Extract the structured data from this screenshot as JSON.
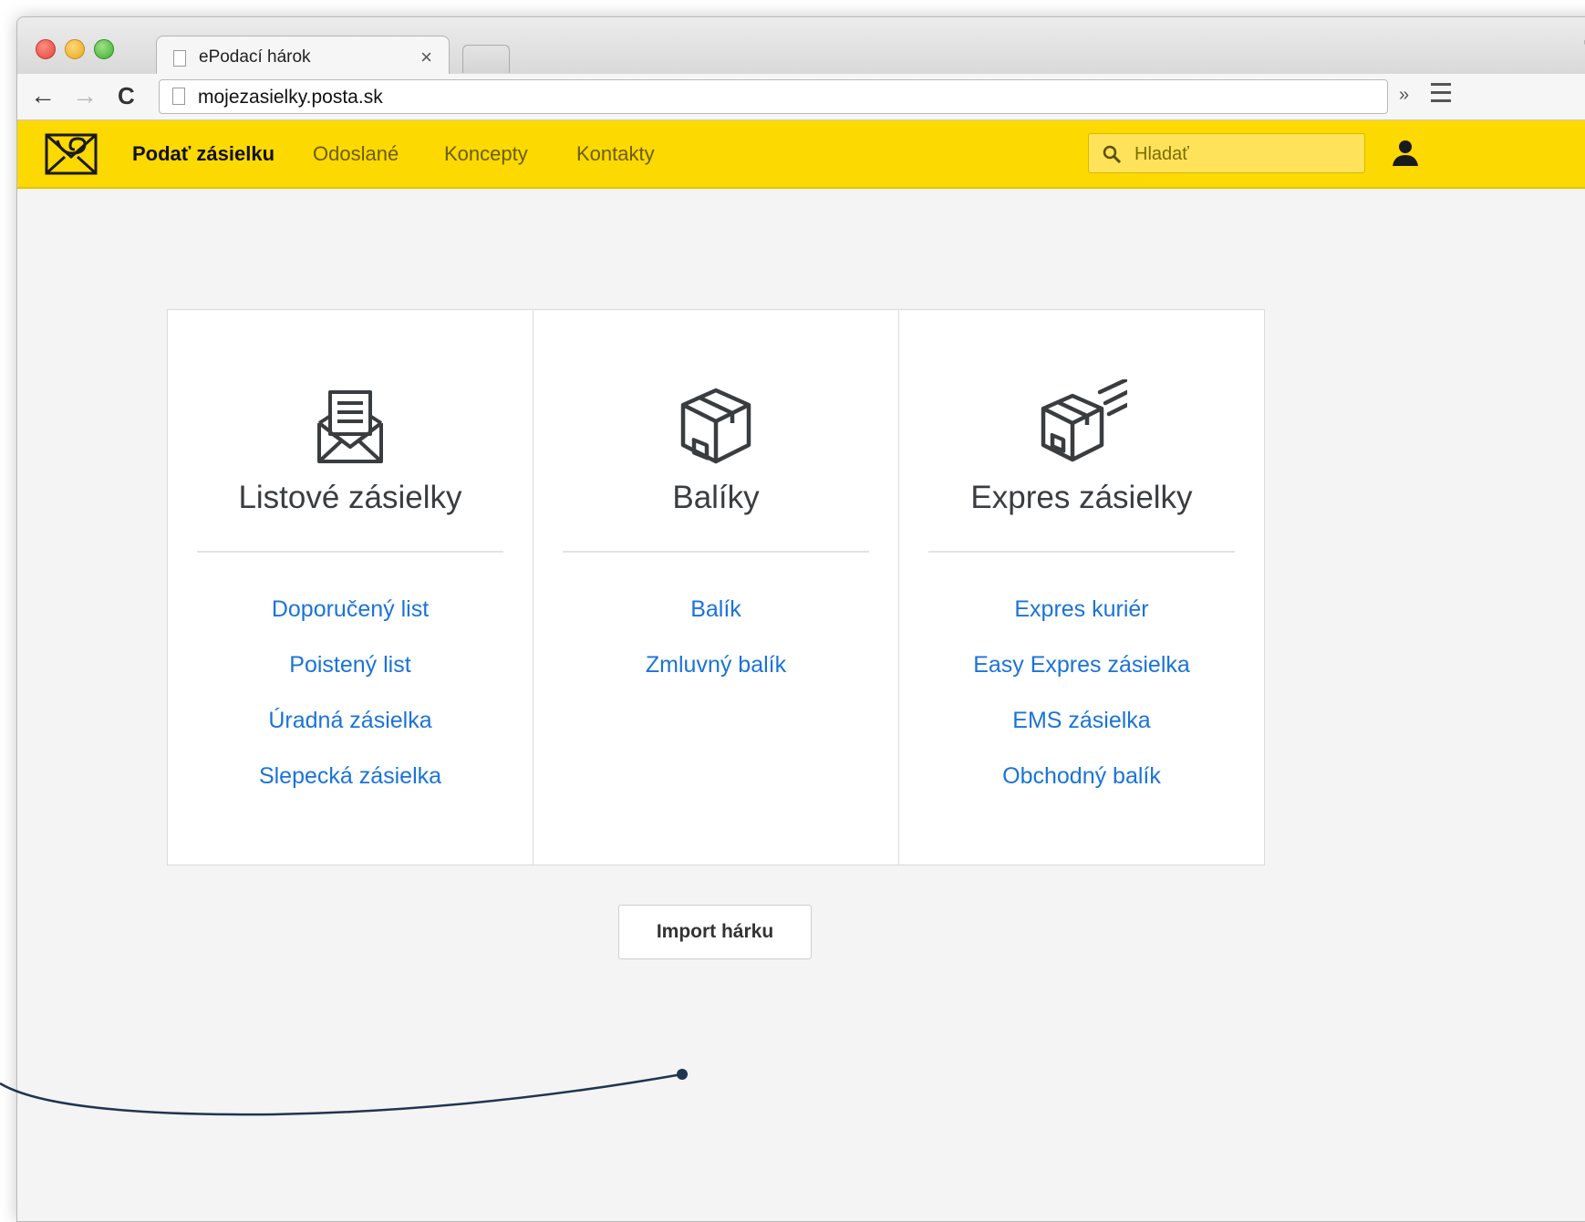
{
  "browser": {
    "tab_title": "ePodací hárok",
    "tab_close": "×",
    "url": "mojezasielky.posta.sk",
    "chevrons": "»",
    "back": "←",
    "forward": "→",
    "reload": "C"
  },
  "appbar": {
    "nav": [
      {
        "label": "Podať zásielku",
        "active": true
      },
      {
        "label": "Odoslané",
        "active": false
      },
      {
        "label": "Koncepty",
        "active": false
      },
      {
        "label": "Kontakty",
        "active": false
      }
    ],
    "search_placeholder": "Hladať",
    "color": "#fcd900"
  },
  "cards": [
    {
      "icon": "envelope-icon",
      "title": "Listové zásielky",
      "links": [
        "Doporučený list",
        "Poistený list",
        "Úradná zásielka",
        "Slepecká zásielka"
      ]
    },
    {
      "icon": "package-icon",
      "title": "Balíky",
      "links": [
        "Balík",
        "Zmluvný balík"
      ]
    },
    {
      "icon": "express-package-icon",
      "title": "Expres zásielky",
      "links": [
        "Expres kuriér",
        "Easy Expres zásielka",
        "EMS zásielka",
        "Obchodný balík"
      ]
    }
  ],
  "import_button": "Import hárku",
  "link_color": "#1a73d9"
}
